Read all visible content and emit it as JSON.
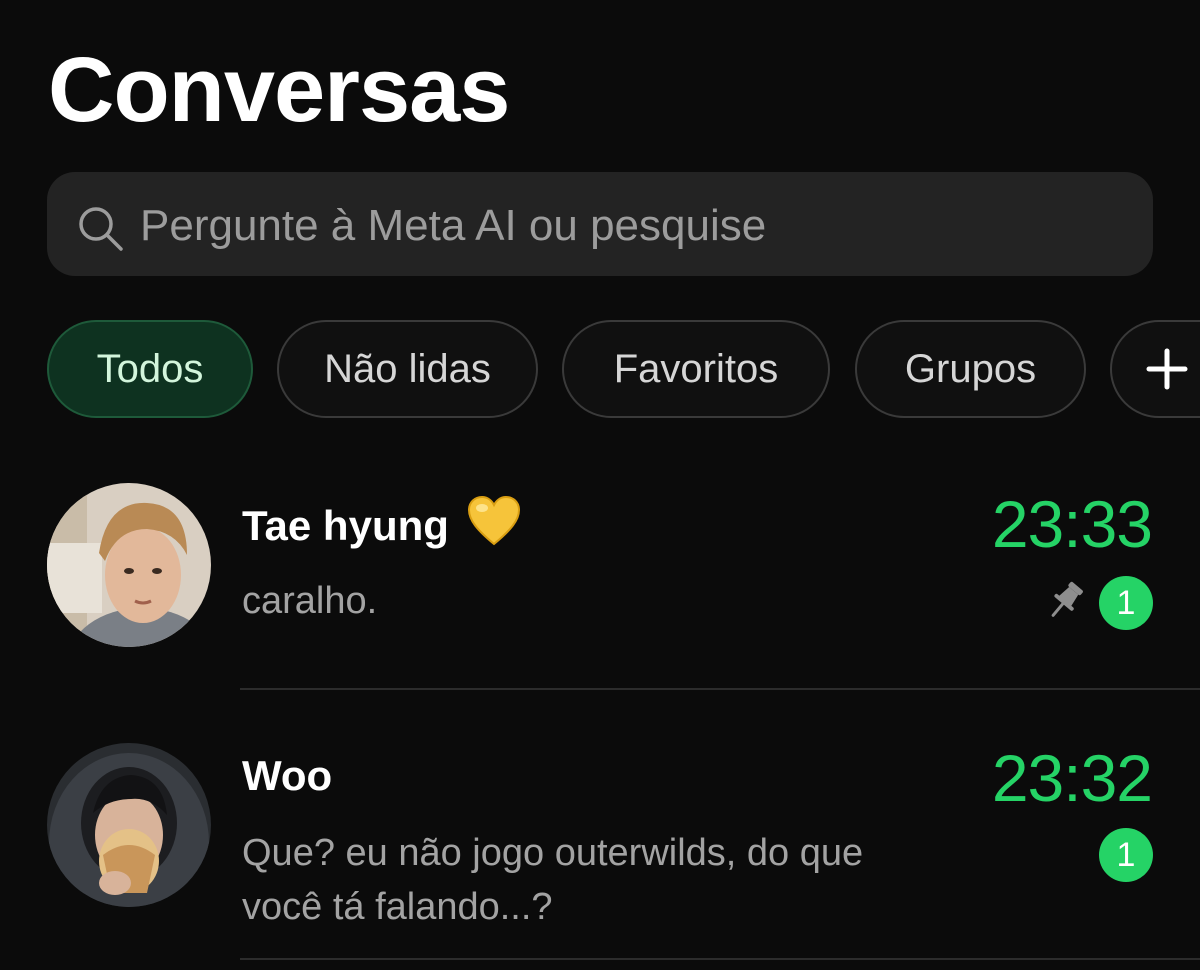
{
  "header": {
    "title": "Conversas"
  },
  "search": {
    "placeholder": "Pergunte à Meta AI ou pesquise"
  },
  "filters": [
    {
      "label": "Todos",
      "active": true
    },
    {
      "label": "Não lidas",
      "active": false
    },
    {
      "label": "Favoritos",
      "active": false
    },
    {
      "label": "Grupos",
      "active": false
    }
  ],
  "chats": [
    {
      "name": "Tae hyung",
      "emoji": "💛",
      "preview": "caralho.",
      "time": "23:33",
      "pinned": true,
      "unread": "1"
    },
    {
      "name": "Woo",
      "preview_line1": "Que? eu não jogo outerwilds, do que",
      "preview_line2": "você tá falando...?",
      "time": "23:32",
      "pinned": false,
      "unread": "1"
    }
  ],
  "colors": {
    "accent": "#25d366",
    "background": "#0b0b0b",
    "active_chip_bg": "#0e3220"
  }
}
